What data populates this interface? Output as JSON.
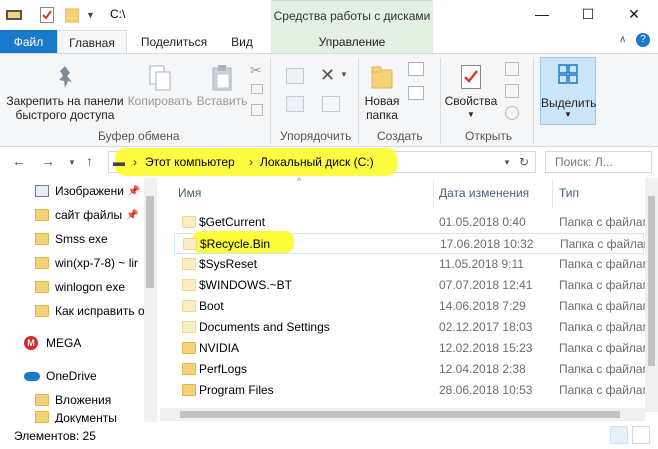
{
  "window": {
    "path": "C:\\",
    "context_header": "Средства работы с дисками",
    "controls": {
      "minimize": "—",
      "maximize": "☐",
      "close": "✕"
    }
  },
  "tabs": {
    "file": "Файл",
    "home": "Главная",
    "share": "Поделиться",
    "view": "Вид",
    "manage": "Управление"
  },
  "ribbon": {
    "pin": "Закрепить на панели быстрого доступа",
    "pin_l1": "Закрепить на панели",
    "pin_l2": "быстрого доступа",
    "copy": "Копировать",
    "paste": "Вставить",
    "clipboard_group": "Буфер обмена",
    "organize_group": "Упорядочить",
    "new_folder_l1": "Новая",
    "new_folder_l2": "папка",
    "create_group": "Создать",
    "properties": "Свойства",
    "open_group": "Открыть",
    "select": "Выделить"
  },
  "address": {
    "computer": "Этот компьютер",
    "disk": "Локальный диск (C:)",
    "search_placeholder": "Поиск: Л..."
  },
  "nav_items": [
    {
      "label": "Изображени",
      "pinned": true
    },
    {
      "label": "сайт файлы",
      "pinned": true
    },
    {
      "label": "Smss exe",
      "pinned": false
    },
    {
      "label": "win(xp-7-8) ~ lir",
      "pinned": false
    },
    {
      "label": "winlogon exe",
      "pinned": false
    },
    {
      "label": "Как исправить о",
      "pinned": false
    },
    {
      "label": "MEGA",
      "pinned": false
    },
    {
      "label": "OneDrive",
      "pinned": false
    },
    {
      "label": "Вложения",
      "pinned": false
    },
    {
      "label": "Документы",
      "pinned": false
    }
  ],
  "columns": {
    "name": "Имя",
    "date": "Дата изменения",
    "type": "Тип"
  },
  "files": [
    {
      "name": "$GetCurrent",
      "date": "01.05.2018 0:40",
      "type": "Папка с файлами"
    },
    {
      "name": "$Recycle.Bin",
      "date": "17.06.2018 10:32",
      "type": "Папка с файлами"
    },
    {
      "name": "$SysReset",
      "date": "11.05.2018 9:11",
      "type": "Папка с файлами"
    },
    {
      "name": "$WINDOWS.~BT",
      "date": "07.07.2018 12:41",
      "type": "Папка с файлами"
    },
    {
      "name": "Boot",
      "date": "14.06.2018 7:29",
      "type": "Папка с файлами"
    },
    {
      "name": "Documents and Settings",
      "date": "02.12.2017 18:03",
      "type": "Папка с файлами"
    },
    {
      "name": "NVIDIA",
      "date": "12.02.2018 15:23",
      "type": "Папка с файлами"
    },
    {
      "name": "PerfLogs",
      "date": "12.04.2018 2:38",
      "type": "Папка с файлами"
    },
    {
      "name": "Program Files",
      "date": "28.06.2018 10:53",
      "type": "Папка с файлами"
    }
  ],
  "status": {
    "count": "Элементов: 25"
  },
  "colors": {
    "file_tab": "#1979ca",
    "context": "#e3f1e3",
    "highlight": "#fdfd3a",
    "selection": "#cce4f7"
  }
}
